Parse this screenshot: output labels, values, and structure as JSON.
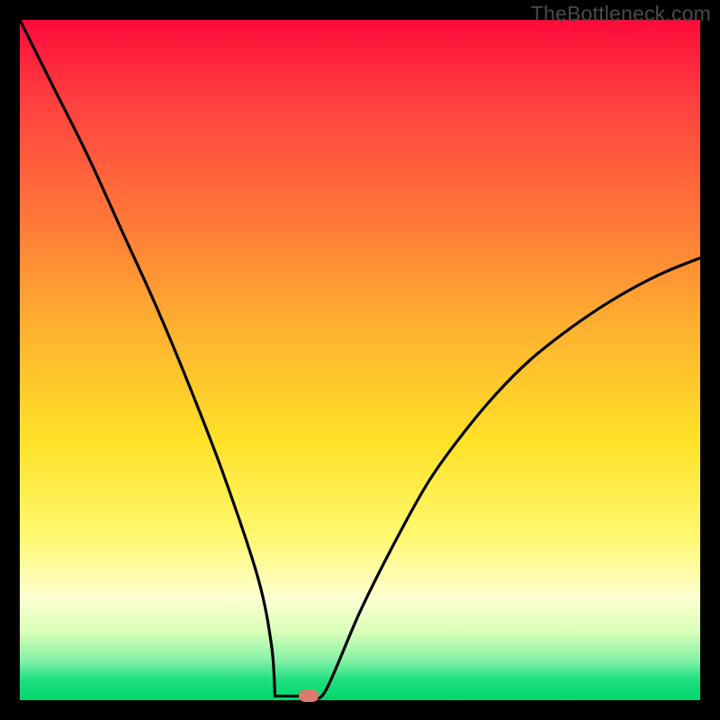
{
  "watermark": "TheBottleneck.com",
  "chart_data": {
    "type": "line",
    "title": "",
    "xlabel": "",
    "ylabel": "",
    "xlim": [
      0,
      100
    ],
    "ylim": [
      0,
      100
    ],
    "x": [
      0,
      5,
      10,
      15,
      20,
      25,
      30,
      35,
      37,
      40,
      43,
      45,
      50,
      55,
      60,
      65,
      70,
      75,
      80,
      85,
      90,
      95,
      100
    ],
    "values": [
      100,
      90,
      80,
      69,
      58,
      46,
      33,
      18,
      8,
      0.8,
      0.5,
      1.5,
      13,
      23,
      32,
      39,
      45,
      50,
      54,
      57.5,
      60.5,
      63,
      65
    ],
    "flat_bottom": {
      "x_from": 37.5,
      "x_to": 42,
      "y": 0.6
    },
    "marker": {
      "x": 42.5,
      "y": 0.6
    },
    "gradient_stops": [
      {
        "pos": 0,
        "color": "#ff0a3a"
      },
      {
        "pos": 30,
        "color": "#ff7a38"
      },
      {
        "pos": 62,
        "color": "#ffe228"
      },
      {
        "pos": 85,
        "color": "#fdffd2"
      },
      {
        "pos": 100,
        "color": "#00d66a"
      }
    ]
  }
}
